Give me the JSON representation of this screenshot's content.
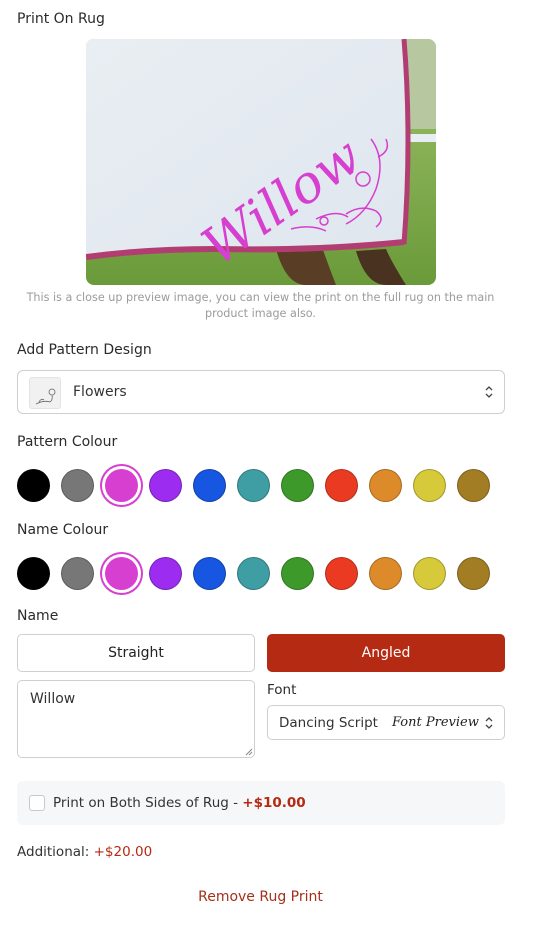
{
  "print_on_rug": {
    "title": "Print On Rug",
    "preview_text": "Willow",
    "caption": "This is a close up preview image, you can view the print on the full rug on the main product image also."
  },
  "pattern_design": {
    "label": "Add Pattern Design",
    "selected": "Flowers"
  },
  "pattern_colour": {
    "label": "Pattern Colour",
    "swatches": [
      "#000000",
      "#777777",
      "#d63fcf",
      "#9b2cf0",
      "#1656e0",
      "#3f9ea3",
      "#3d9a2a",
      "#ea3b22",
      "#dd8a2a",
      "#d6c93a",
      "#a37d24"
    ],
    "selected_index": 2
  },
  "name_colour": {
    "label": "Name Colour",
    "swatches": [
      "#000000",
      "#777777",
      "#d63fcf",
      "#9b2cf0",
      "#1656e0",
      "#3f9ea3",
      "#3d9a2a",
      "#ea3b22",
      "#dd8a2a",
      "#d6c93a",
      "#a37d24"
    ],
    "selected_index": 2
  },
  "name": {
    "label": "Name",
    "straight_label": "Straight",
    "angled_label": "Angled",
    "active_style": "Angled",
    "value": "Willow"
  },
  "font": {
    "label": "Font",
    "selected": "Dancing Script",
    "preview": "Font Preview"
  },
  "both_sides": {
    "label": "Print on Both Sides of Rug - ",
    "price": "+$10.00",
    "checked": false
  },
  "additional": {
    "label": "Additional: ",
    "price": "+$20.00"
  },
  "remove_label": "Remove Rug Print",
  "colors": {
    "accent": "#b52a12",
    "preview_pink": "#d63fcf"
  }
}
